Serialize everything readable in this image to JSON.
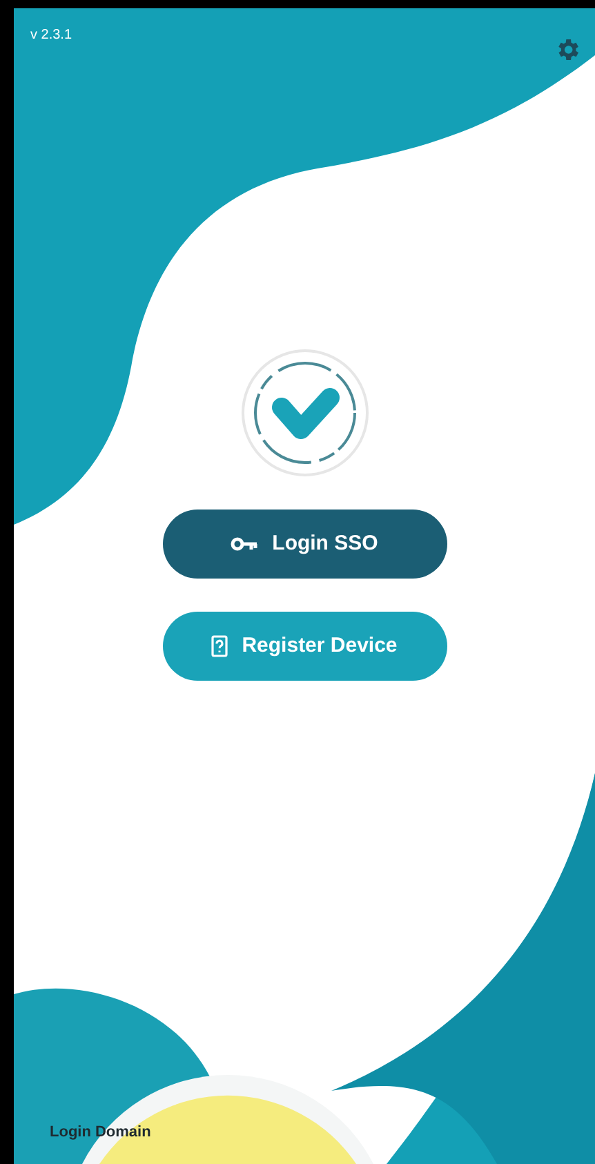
{
  "version": "v 2.3.1",
  "buttons": [
    {
      "kind": "primary",
      "label": "Login SSO"
    },
    {
      "kind": "secondary",
      "label": "Register Device"
    }
  ],
  "footer": {
    "link": "Login Domain"
  }
}
